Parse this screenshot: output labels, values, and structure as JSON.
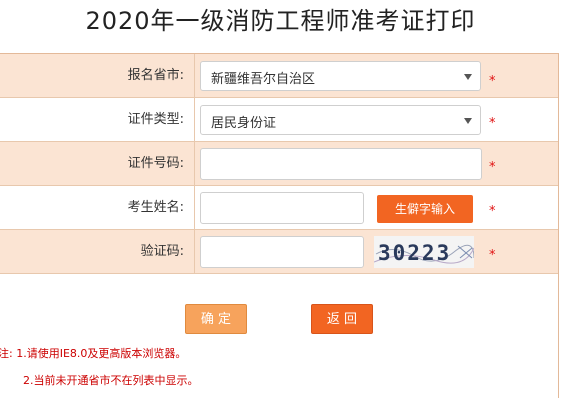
{
  "title": "2020年一级消防工程师准考证打印",
  "form": {
    "province": {
      "label": "报名省市:",
      "value": "新疆维吾尔自治区"
    },
    "id_type": {
      "label": "证件类型:",
      "value": "居民身份证"
    },
    "id_number": {
      "label": "证件号码:",
      "value": ""
    },
    "name": {
      "label": "考生姓名:",
      "value": "",
      "rare_char_button": "生僻字输入"
    },
    "captcha": {
      "label": "验证码:",
      "value": "",
      "image_text": "30223"
    },
    "required_mark": "*"
  },
  "actions": {
    "confirm": "确 定",
    "back": "返 回"
  },
  "notes": [
    "注: 1.请使用IE8.0及更高版本浏览器。",
    "2.当前未开通省市不在列表中显示。"
  ],
  "colors": {
    "row_shade": "#fbe4d3",
    "accent": "#f26522",
    "required": "#e01010"
  }
}
